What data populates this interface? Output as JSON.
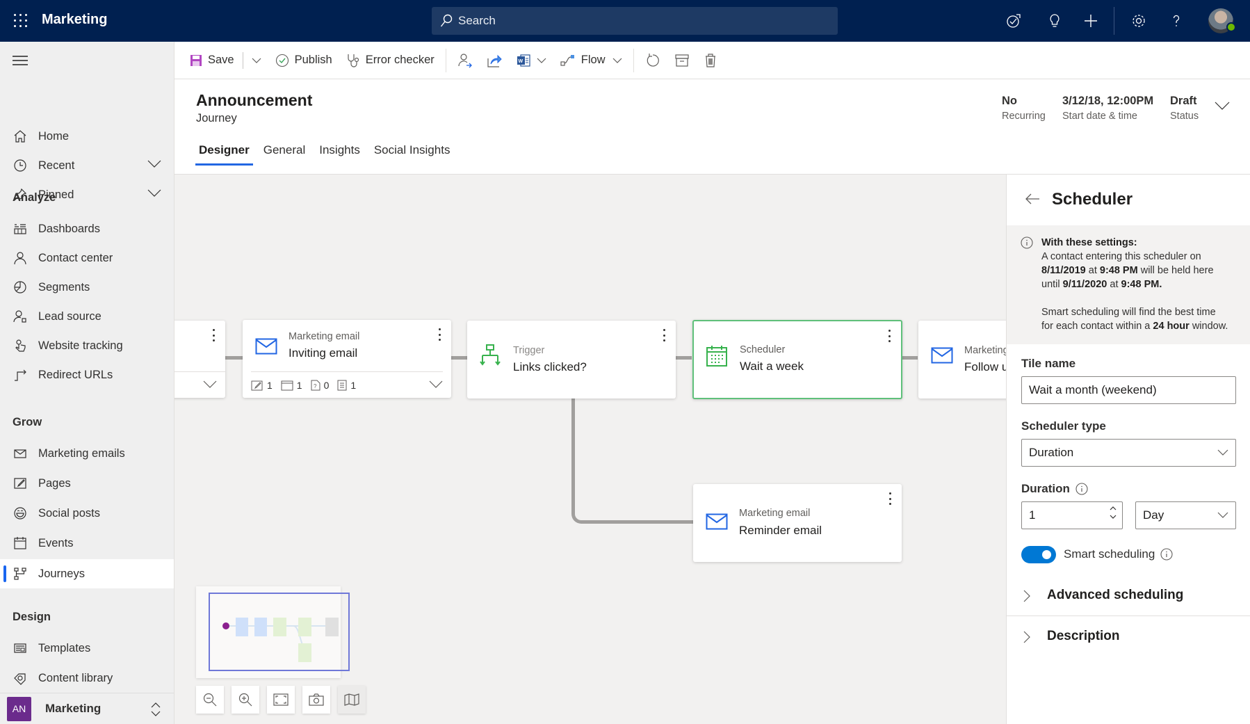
{
  "topbar": {
    "app_title": "Marketing",
    "search_placeholder": "Search",
    "icons": [
      "task-flow-icon",
      "lightbulb-icon",
      "plus-icon",
      "settings-icon",
      "help-icon"
    ],
    "presence_color": "#6bb700"
  },
  "sidebar": {
    "top_items": [
      {
        "label": "Home",
        "icon": "home-icon"
      },
      {
        "label": "Recent",
        "icon": "clock-icon",
        "expandable": true
      },
      {
        "label": "Pinned",
        "icon": "pin-icon",
        "expandable": true
      }
    ],
    "groups": [
      {
        "title": "Analyze",
        "items": [
          {
            "label": "Dashboards",
            "icon": "dashboard-icon"
          },
          {
            "label": "Contact center",
            "icon": "person-icon"
          },
          {
            "label": "Segments",
            "icon": "segments-icon"
          },
          {
            "label": "Lead source",
            "icon": "lead-icon"
          },
          {
            "label": "Website tracking",
            "icon": "touch-icon"
          },
          {
            "label": "Redirect URLs",
            "icon": "redirect-icon"
          }
        ]
      },
      {
        "title": "Grow",
        "items": [
          {
            "label": "Marketing emails",
            "icon": "mail-icon"
          },
          {
            "label": "Pages",
            "icon": "page-edit-icon"
          },
          {
            "label": "Social posts",
            "icon": "emoji-icon"
          },
          {
            "label": "Events",
            "icon": "calendar-icon"
          },
          {
            "label": "Journeys",
            "icon": "journey-icon",
            "active": true
          }
        ]
      },
      {
        "title": "Design",
        "items": [
          {
            "label": "Templates",
            "icon": "template-icon"
          },
          {
            "label": "Content library",
            "icon": "tag-icon"
          }
        ]
      }
    ],
    "area": {
      "badge": "AN",
      "label": "Marketing",
      "badge_color": "#6b2b8c"
    }
  },
  "commandbar": {
    "save": "Save",
    "publish": "Publish",
    "error_checker": "Error checker",
    "flow": "Flow",
    "icon_buttons": [
      "assign-icon",
      "share-icon",
      "word-icon",
      "refresh-icon",
      "archive-icon",
      "delete-icon"
    ]
  },
  "header": {
    "title": "Announcement",
    "entity": "Journey",
    "fields": [
      {
        "value": "No",
        "label": "Recurring"
      },
      {
        "value": "3/12/18, 12:00PM",
        "label": "Start date & time"
      },
      {
        "value": "Draft",
        "label": "Status"
      }
    ],
    "tabs": [
      {
        "label": "Designer",
        "active": true
      },
      {
        "label": "General"
      },
      {
        "label": "Insights"
      },
      {
        "label": "Social Insights"
      }
    ]
  },
  "canvas": {
    "tiles": [
      {
        "type": "",
        "name": "",
        "partial": true
      },
      {
        "type": "Marketing email",
        "name": "Inviting email",
        "stats": [
          {
            "icon": "page-edit-icon",
            "value": "1"
          },
          {
            "icon": "calendar-icon",
            "value": "1"
          },
          {
            "icon": "question-doc-icon",
            "value": "0"
          },
          {
            "icon": "list-icon",
            "value": "1"
          }
        ]
      },
      {
        "type": "Trigger",
        "name": "Links clicked?"
      },
      {
        "type": "Scheduler",
        "name": "Wait a week",
        "selected": true
      },
      {
        "type": "Marketing email",
        "name": "Follow up",
        "partial": true
      },
      {
        "type": "Marketing email",
        "name": "Reminder email"
      }
    ],
    "zoom_controls": [
      "zoom-out-icon",
      "zoom-in-icon",
      "fit-screen-icon",
      "screenshot-icon",
      "minimap-icon"
    ],
    "accent_email": "#2266e3",
    "accent_trigger": "#37b24d"
  },
  "panel": {
    "title": "Scheduler",
    "info": {
      "heading": "With these settings:",
      "line1": "A contact entering this scheduler on",
      "start_date": "8/11/2019",
      "at": "at",
      "start_time": "9:48 PM",
      "held": "will be held here",
      "until": "until",
      "end_date": "9/11/2020",
      "end_time": "9:48 PM.",
      "smart_line1": "Smart scheduling will find the best time",
      "smart_pre": "for each contact within a",
      "smart_window": "24 hour",
      "smart_post": "window."
    },
    "tile_name_label": "Tile name",
    "tile_name_value": "Wait a month (weekend)",
    "scheduler_type_label": "Scheduler type",
    "scheduler_type_value": "Duration",
    "duration_label": "Duration",
    "duration_value": "1",
    "duration_unit": "Day",
    "smart_scheduling_label": "Smart scheduling",
    "smart_scheduling_on": true,
    "sections": [
      "Advanced scheduling",
      "Description"
    ]
  }
}
